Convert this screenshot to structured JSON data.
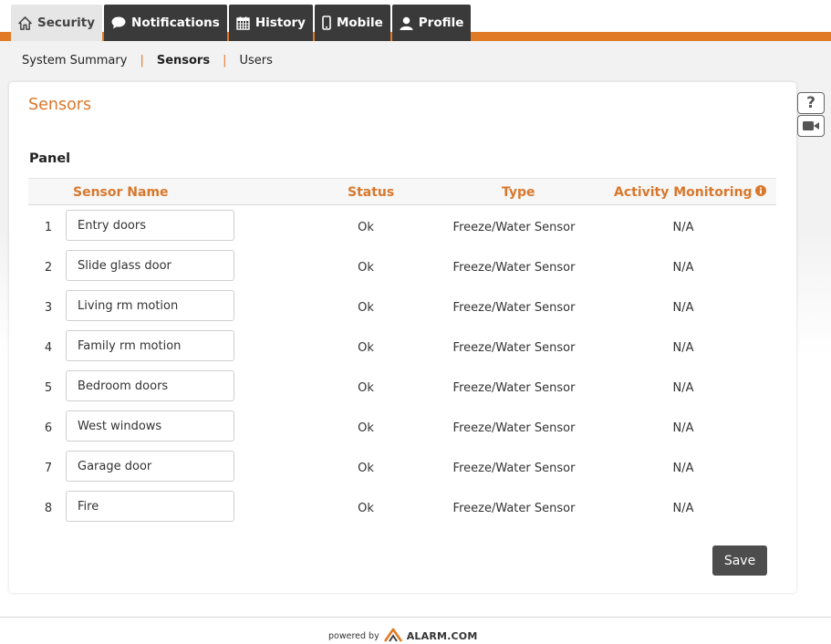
{
  "tabs": [
    {
      "label": "Security",
      "icon": "home-icon",
      "active": true
    },
    {
      "label": "Notifications",
      "icon": "speech-bubble-icon",
      "active": false
    },
    {
      "label": "History",
      "icon": "calendar-icon",
      "active": false
    },
    {
      "label": "Mobile",
      "icon": "phone-icon",
      "active": false
    },
    {
      "label": "Profile",
      "icon": "user-icon",
      "active": false
    }
  ],
  "subnav": {
    "items": [
      "System Summary",
      "Sensors",
      "Users"
    ],
    "active": "Sensors",
    "separator": "|"
  },
  "page": {
    "title": "Sensors",
    "panel_heading": "Panel"
  },
  "table": {
    "headers": {
      "sensor_name": "Sensor Name",
      "status": "Status",
      "type": "Type",
      "activity": "Activity Monitoring"
    },
    "rows": [
      {
        "num": "1",
        "name": "Entry doors",
        "status": "Ok",
        "type": "Freeze/Water Sensor",
        "activity": "N/A"
      },
      {
        "num": "2",
        "name": "Slide glass door",
        "status": "Ok",
        "type": "Freeze/Water Sensor",
        "activity": "N/A"
      },
      {
        "num": "3",
        "name": "Living rm motion",
        "status": "Ok",
        "type": "Freeze/Water Sensor",
        "activity": "N/A"
      },
      {
        "num": "4",
        "name": "Family rm motion",
        "status": "Ok",
        "type": "Freeze/Water Sensor",
        "activity": "N/A"
      },
      {
        "num": "5",
        "name": "Bedroom doors",
        "status": "Ok",
        "type": "Freeze/Water Sensor",
        "activity": "N/A"
      },
      {
        "num": "6",
        "name": "West windows",
        "status": "Ok",
        "type": "Freeze/Water Sensor",
        "activity": "N/A"
      },
      {
        "num": "7",
        "name": "Garage door",
        "status": "Ok",
        "type": "Freeze/Water Sensor",
        "activity": "N/A"
      },
      {
        "num": "8",
        "name": "Fire",
        "status": "Ok",
        "type": "Freeze/Water Sensor",
        "activity": "N/A"
      }
    ]
  },
  "actions": {
    "save_label": "Save"
  },
  "side_icons": {
    "help": "?",
    "help_icon": "help-icon",
    "video_icon": "video-camera-icon"
  },
  "footer": {
    "powered_by": "powered by",
    "brand": "ALARM.COM"
  },
  "colors": {
    "accent": "#e07a24",
    "tab_bg": "#3a3a3a",
    "heading": "#d9782c",
    "button": "#4d4d4d"
  }
}
